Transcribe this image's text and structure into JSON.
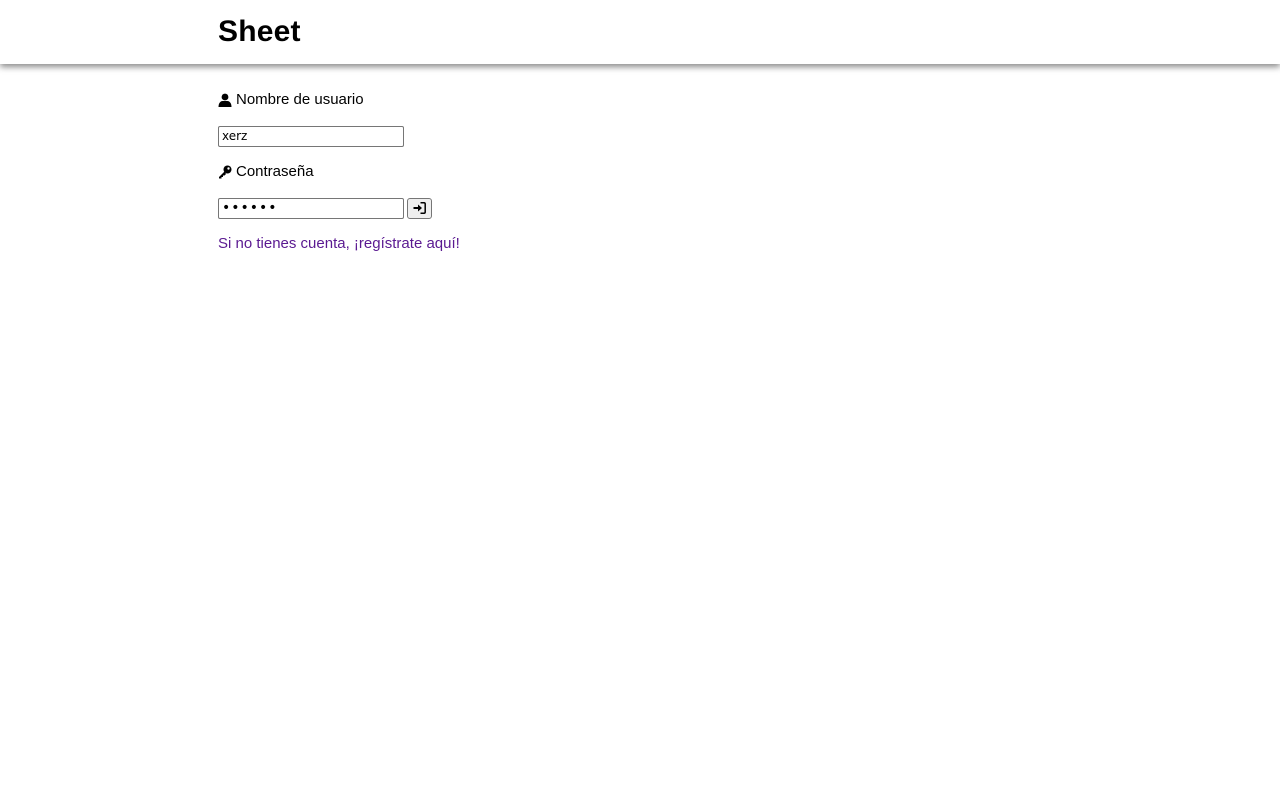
{
  "header": {
    "title": "Sheet"
  },
  "login_form": {
    "username": {
      "label": "Nombre de usuario",
      "value": "xerz",
      "icon": "user-icon"
    },
    "password": {
      "label": "Contraseña",
      "value": "••••••",
      "icon": "key-icon"
    },
    "submit": {
      "icon": "sign-in-icon"
    },
    "register_link": "Si no tienes cuenta, ¡regístrate aquí!"
  },
  "colors": {
    "link": "#5a1991",
    "text": "#000000",
    "background": "#ffffff"
  }
}
